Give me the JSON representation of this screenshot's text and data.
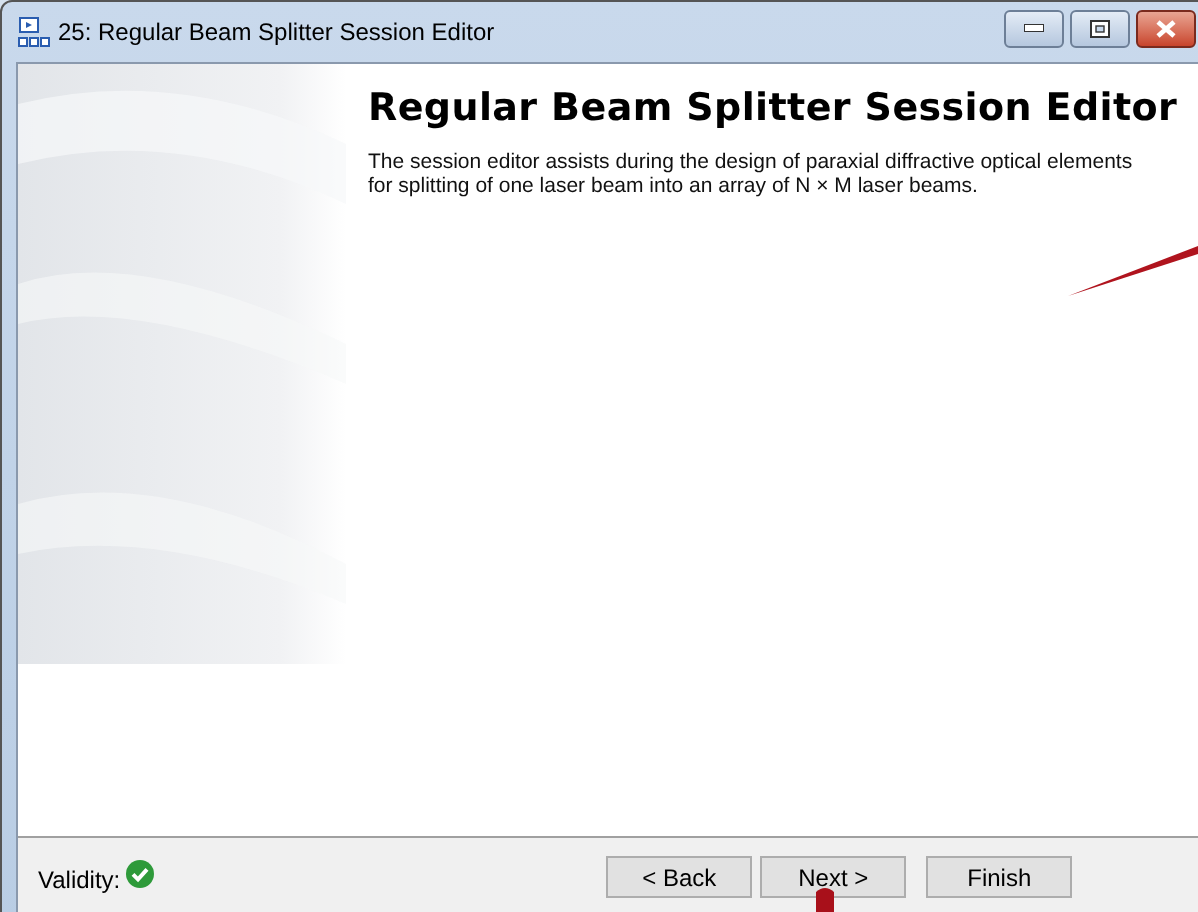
{
  "window": {
    "title": "25: Regular Beam Splitter Session Editor"
  },
  "page": {
    "heading": "Regular Beam Splitter Session Editor",
    "description": "The session editor assists during the design of paraxial diffractive optical elements for splitting of one laser beam into an array of N × M laser beams."
  },
  "footer": {
    "validity_label": "Validity:",
    "valid": true,
    "buttons": [
      {
        "label": "< Back"
      },
      {
        "label": "Next >"
      },
      {
        "label": "Finish"
      }
    ]
  }
}
